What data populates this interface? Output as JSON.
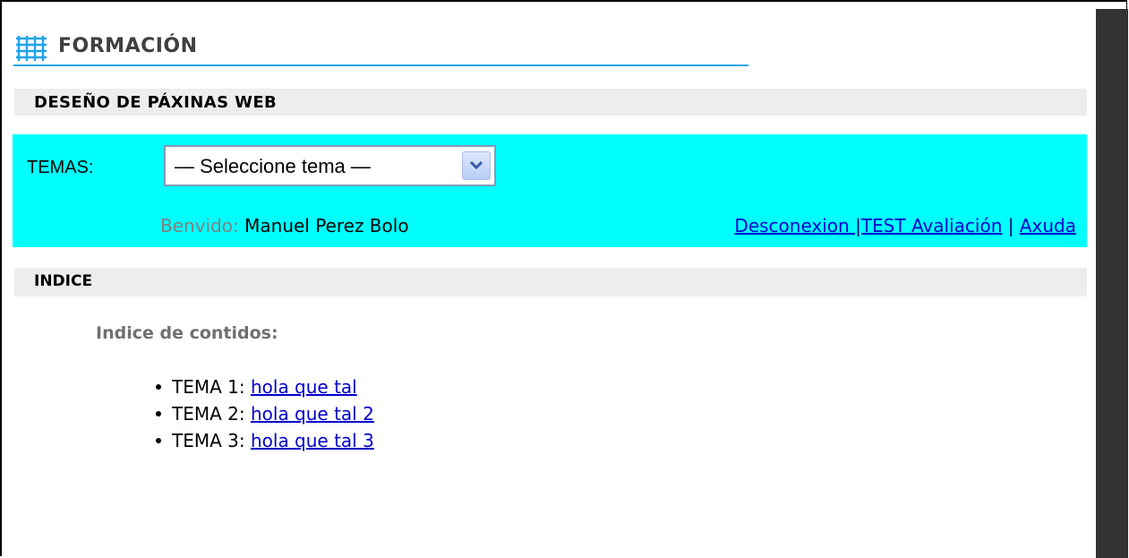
{
  "header": {
    "title": "FORMACIÓN",
    "icon": "grid-icon",
    "accent_color": "#1fa3e6"
  },
  "course": {
    "title": "DESEÑO DE PÁXINAS WEB"
  },
  "panel": {
    "background_color": "#00ffff",
    "temas_label": "TEMAS:",
    "select_value": "— Seleccione tema —",
    "welcome_label": "Benvido:",
    "user_name": "Manuel Perez Bolo",
    "links": {
      "logout": "Desconexion ",
      "separator1": "|",
      "test": "TEST Avaliación",
      "separator2": " | ",
      "help": "Axuda"
    }
  },
  "index": {
    "bar_title": "INDICE",
    "heading": "Indice de contidos:",
    "topics": [
      {
        "label": "TEMA 1: ",
        "link": "hola que tal"
      },
      {
        "label": "TEMA 2: ",
        "link": "hola que tal 2"
      },
      {
        "label": "TEMA 3: ",
        "link": "hola que tal 3"
      }
    ]
  }
}
